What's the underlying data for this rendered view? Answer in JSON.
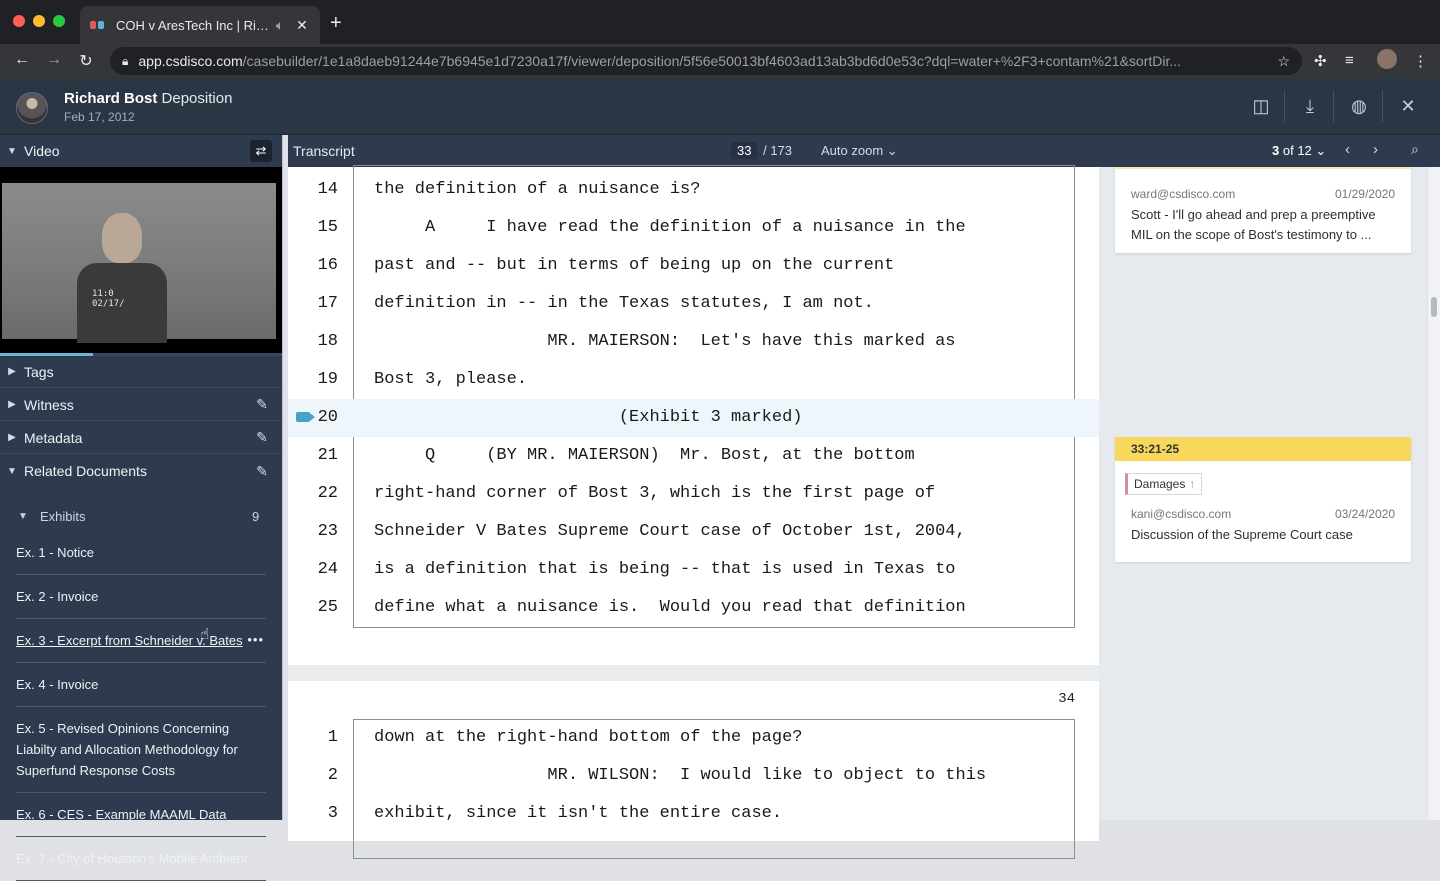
{
  "browser": {
    "tab_title": "COH v AresTech Inc | Richard Bost Deposition",
    "url_host": "app.csdisco.com",
    "url_path": "/casebuilder/1e1a8daeb91244e7b6945e1d7230a17f/viewer/deposition/5f56e50013bf4603ad13ab3bd6d0e53c?dql=water+%2F3+contam%21&sortDir..."
  },
  "header": {
    "witness_name": "Richard Bost",
    "doc_type": "Deposition",
    "date": "Feb 17, 2012"
  },
  "sidebar": {
    "video_label": "Video",
    "video_stamp": "11:0\n02/17/",
    "sections": [
      {
        "label": "Tags"
      },
      {
        "label": "Witness"
      },
      {
        "label": "Metadata"
      },
      {
        "label": "Related Documents"
      }
    ],
    "exhibits_label": "Exhibits",
    "exhibits_count": "9",
    "exhibits": [
      {
        "label": "Ex. 1 - Notice"
      },
      {
        "label": "Ex. 2 - Invoice"
      },
      {
        "label": "Ex. 3 - Excerpt from Schneider v. Bates"
      },
      {
        "label": "Ex. 4 - Invoice"
      },
      {
        "label": "Ex. 5 - Revised Opinions Concerning Liabilty and Allocation Methodology for Superfund Response Costs"
      },
      {
        "label": "Ex. 6 - CES - Example MAAML Data"
      },
      {
        "label": "Ex. 7 - City of Houston's Mobile Ambient"
      }
    ]
  },
  "transcript": {
    "title": "Transcript",
    "current_page": "33",
    "total_pages": "/ 173",
    "zoom": "Auto zoom",
    "hit_current": "3",
    "hit_of": "of 12",
    "page33_lines": [
      {
        "no": "14",
        "text": "the definition of a nuisance is?"
      },
      {
        "no": "15",
        "text": "     A     I have read the definition of a nuisance in the"
      },
      {
        "no": "16",
        "text": "past and -- but in terms of being up on the current"
      },
      {
        "no": "17",
        "text": "definition in -- in the Texas statutes, I am not."
      },
      {
        "no": "18",
        "text": "                 MR. MAIERSON:  Let's have this marked as"
      },
      {
        "no": "19",
        "text": "Bost 3, please."
      },
      {
        "no": "20",
        "text": "                        (Exhibit 3 marked)"
      },
      {
        "no": "21",
        "text": "     Q     (BY MR. MAIERSON)  Mr. Bost, at the bottom"
      },
      {
        "no": "22",
        "text": "right-hand corner of Bost 3, which is the first page of"
      },
      {
        "no": "23",
        "text": "Schneider V Bates Supreme Court case of October 1st, 2004,"
      },
      {
        "no": "24",
        "text": "is a definition that is being -- that is used in Texas to"
      },
      {
        "no": "25",
        "text": "define what a nuisance is.  Would you read that definition"
      }
    ],
    "page34_number": "34",
    "page34_lines": [
      {
        "no": "1",
        "text": "down at the right-hand bottom of the page?"
      },
      {
        "no": "2",
        "text": "                 MR. WILSON:  I would like to object to this"
      },
      {
        "no": "3",
        "text": "exhibit, since it isn't the entire case."
      }
    ]
  },
  "notes": [
    {
      "author": "ward@csdisco.com",
      "date": "01/29/2020",
      "text": "Scott - I'll go ahead and prep a preemptive MIL on the scope of Bost's testimony to ..."
    },
    {
      "ref": "33:21-25",
      "tag": "Damages",
      "author": "kani@csdisco.com",
      "date": "03/24/2020",
      "text": "Discussion of the Supreme Court case"
    }
  ],
  "colors": {
    "highlight": "#eef6fb",
    "note_ref": "#f7d85a",
    "accent": "#4aa3c7"
  }
}
